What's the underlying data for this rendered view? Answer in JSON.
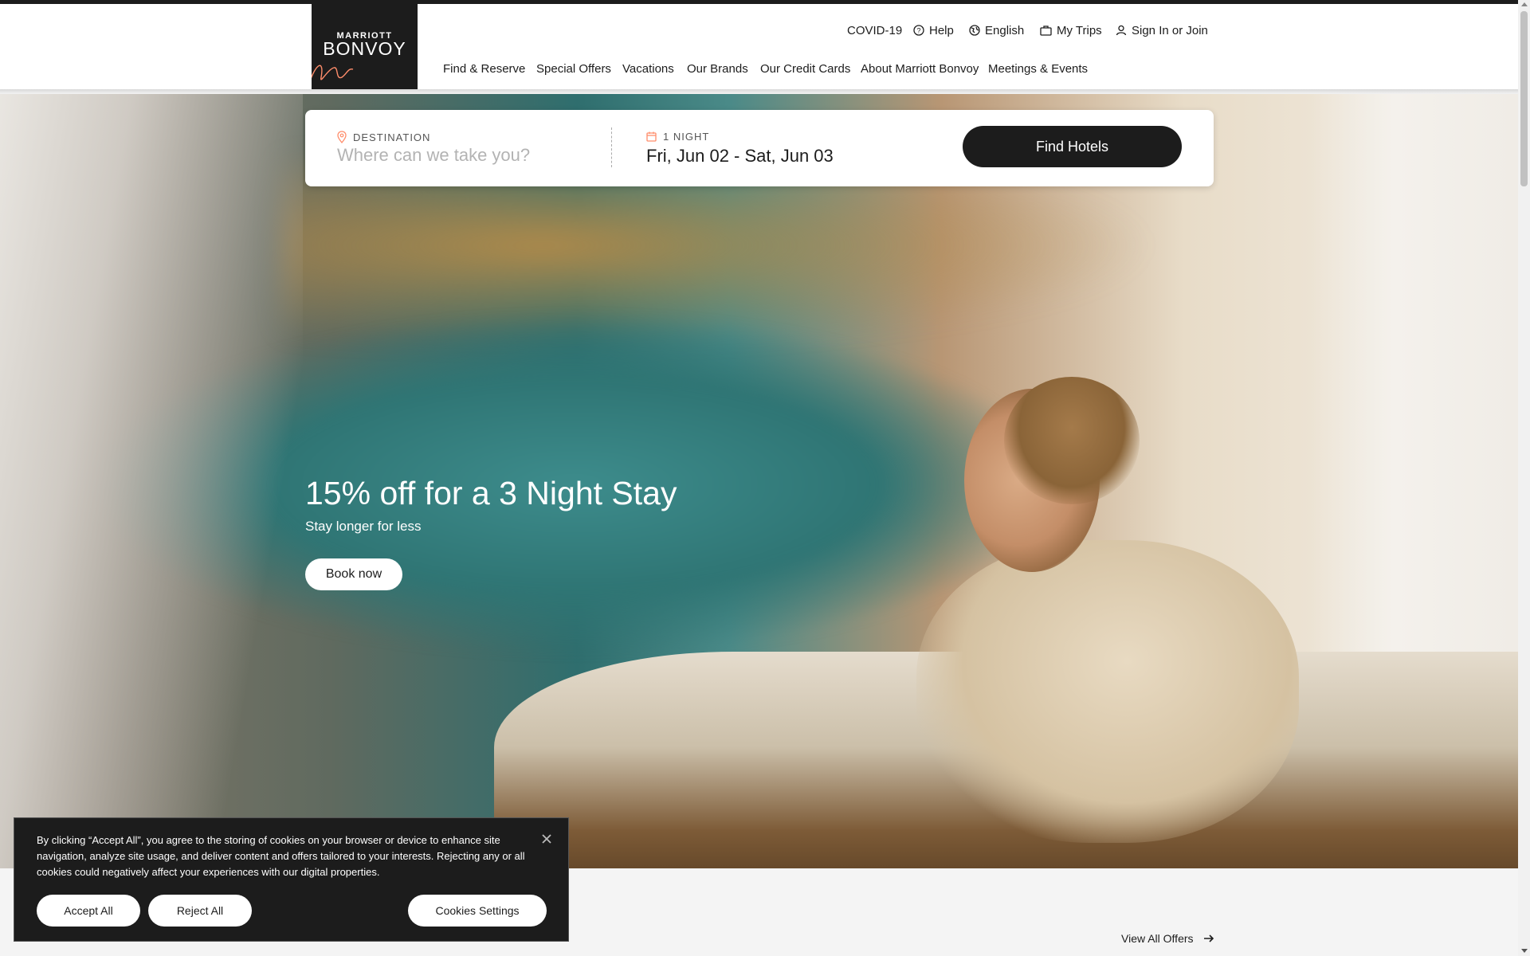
{
  "logo": {
    "line1": "MARRIOTT",
    "line2": "BONVOY"
  },
  "utility_nav": [
    {
      "label": "COVID-19",
      "icon": ""
    },
    {
      "label": "Help",
      "icon": "help-circle-icon"
    },
    {
      "label": "English",
      "icon": "globe-icon"
    },
    {
      "label": "My Trips",
      "icon": "suitcase-icon"
    },
    {
      "label": "Sign In or Join",
      "icon": "user-icon"
    }
  ],
  "main_nav": [
    "Find & Reserve",
    "Special Offers",
    "Vacations",
    "Our Brands",
    "Our Credit Cards",
    "About Marriott Bonvoy",
    "Meetings & Events"
  ],
  "search": {
    "destination_label": "DESTINATION",
    "destination_placeholder": "Where can we take you?",
    "destination_value": "",
    "nights_label": "1 NIGHT",
    "dates_value": "Fri, Jun 02 - Sat, Jun 03",
    "find_button": "Find Hotels"
  },
  "hero": {
    "title": "15% off for a 3 Night Stay",
    "subtitle": "Stay longer for less",
    "cta": "Book now"
  },
  "offers": {
    "view_all": "View All Offers"
  },
  "cookie_banner": {
    "text": "By clicking “Accept All”, you agree to the storing of cookies on your browser or device to enhance site navigation, analyze site usage, and deliver content and offers tailored to your interests. Rejecting any or all cookies could negatively affect your experiences with our digital properties.",
    "accept": "Accept All",
    "reject": "Reject All",
    "settings": "Cookies Settings"
  },
  "colors": {
    "brand_dark": "#1c1c1c",
    "accent": "#ff8d6b",
    "white": "#ffffff"
  }
}
